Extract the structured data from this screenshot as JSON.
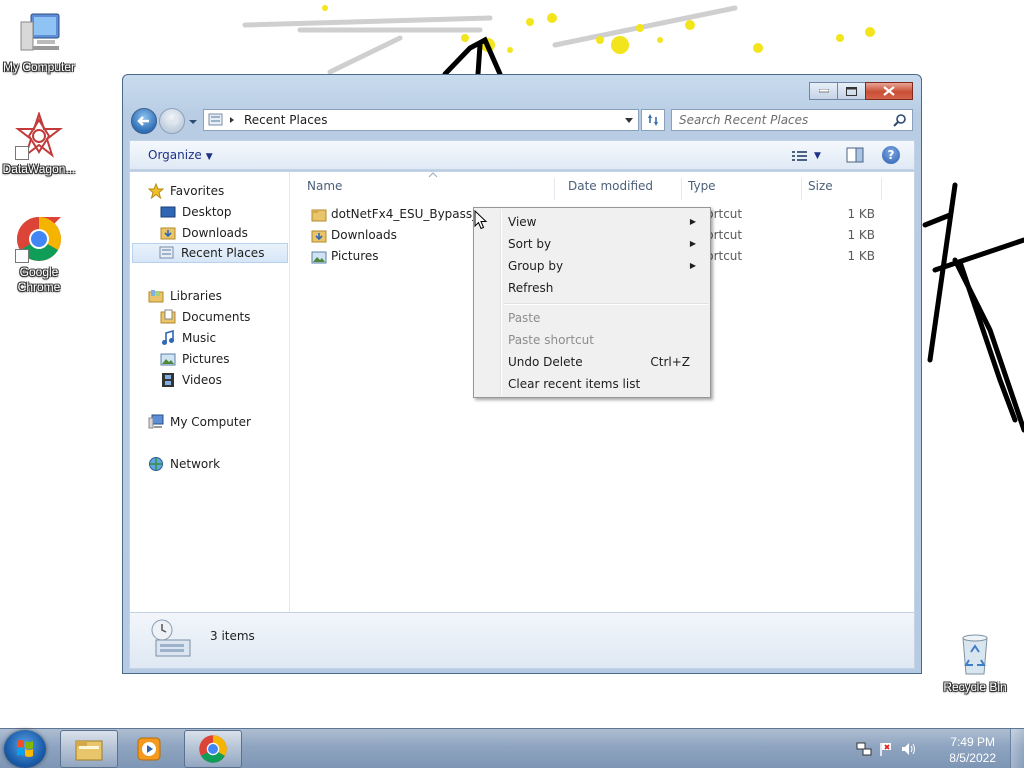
{
  "desktop": {
    "icons": [
      {
        "label": "My Computer"
      },
      {
        "label": "DataWagon..."
      },
      {
        "label": "Google Chrome"
      },
      {
        "label": "Recycle Bin"
      }
    ]
  },
  "window": {
    "address": {
      "location": "Recent Places"
    },
    "search": {
      "placeholder": "Search Recent Places"
    },
    "toolbar": {
      "organize_label": "Organize"
    },
    "nav": {
      "favorites": "Favorites",
      "desktop": "Desktop",
      "downloads": "Downloads",
      "recent_places": "Recent Places",
      "libraries": "Libraries",
      "documents": "Documents",
      "music": "Music",
      "pictures": "Pictures",
      "videos": "Videos",
      "my_computer": "My Computer",
      "network": "Network"
    },
    "columns": {
      "name": "Name",
      "date_modified": "Date modified",
      "type": "Type",
      "size": "Size"
    },
    "files": [
      {
        "name": "dotNetFx4_ESU_Bypass_v5",
        "type": "Shortcut",
        "size": "1 KB"
      },
      {
        "name": "Downloads",
        "type": "Shortcut",
        "size": "1 KB"
      },
      {
        "name": "Pictures",
        "type": "Shortcut",
        "size": "1 KB"
      }
    ],
    "status": {
      "items_count": "3 items"
    }
  },
  "context_menu": {
    "view": "View",
    "sort_by": "Sort by",
    "group_by": "Group by",
    "refresh": "Refresh",
    "paste": "Paste",
    "paste_shortcut": "Paste shortcut",
    "undo_delete": "Undo Delete",
    "undo_delete_shortcut": "Ctrl+Z",
    "clear_recent": "Clear recent items list"
  },
  "taskbar": {
    "clock_time": "7:49 PM",
    "clock_date": "8/5/2022"
  }
}
